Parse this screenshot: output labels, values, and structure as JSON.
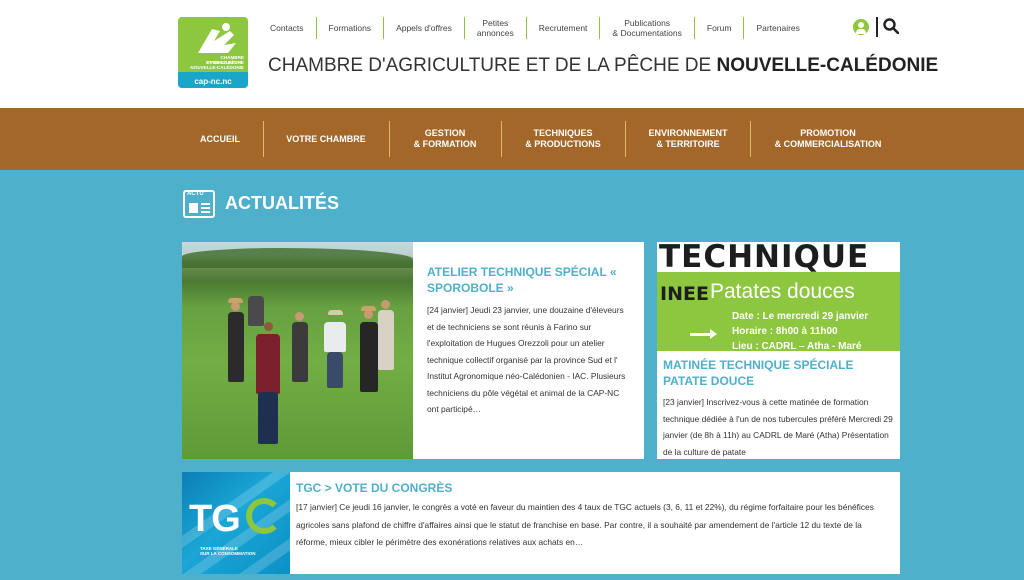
{
  "logo": {
    "lines": [
      "CHAMBRE D'AGRICULTURE",
      "ET DE LA PÊCHE",
      "NOUVELLE-CALÉDONIE"
    ],
    "url": "cap-nc.nc"
  },
  "topnav": [
    {
      "label": "Contacts"
    },
    {
      "label": "Formations"
    },
    {
      "label": "Appels d'offres"
    },
    {
      "label": "Petites\nannonces"
    },
    {
      "label": "Recrutement"
    },
    {
      "label": "Publications\n& Documentations"
    },
    {
      "label": "Forum"
    },
    {
      "label": "Partenaires"
    }
  ],
  "header": {
    "title_prefix": "CHAMBRE D'AGRICULTURE ET DE LA PÊCHE DE ",
    "title_bold": "NOUVELLE-CALÉDONIE"
  },
  "mainnav": [
    {
      "label": "ACCUEIL"
    },
    {
      "label": "VOTRE CHAMBRE"
    },
    {
      "label": "GESTION\n& FORMATION"
    },
    {
      "label": "TECHNIQUES\n& PRODUCTIONS"
    },
    {
      "label": "ENVIRONNEMENT\n& TERRITOIRE"
    },
    {
      "label": "PROMOTION\n& COMMERCIALISATION"
    }
  ],
  "section": {
    "icon_tag": "ACTU",
    "title": "ACTUALITÉS"
  },
  "articles": [
    {
      "title": "ATELIER TECHNIQUE SPÉCIAL « SPOROBOLE »",
      "text": "[24 janvier] Jeudi 23 janvier, une douzaine d'éleveurs et de techniciens se sont réunis à Farino sur l'exploitation de Hugues Orezzoli pour un atelier technique collectif organisé par la province Sud et l' Institut Agronomique néo-Calédonien - IAC. Plusieurs techniciens du pôle végétal et animal de la CAP-NC ont participé…"
    },
    {
      "title": "MATINÉE TECHNIQUE SPÉCIALE PATATE DOUCE",
      "text": "[23 janvier] Inscrivez-vous à cette matinée de formation technique dédiée à l'un de nos tubercules préféré  Mercredi 29 janvier (de 8h à 11h) au CADRL de Maré (Atha) Présentation de la culture de patate",
      "poster": {
        "heading": "TECHNIQUE",
        "vertical": "INEE",
        "subtitle": "Patates douces",
        "lines": [
          "Date : Le mercredi 29 janvier",
          "Horaire : 8h00 à 11h00",
          "Lieu : CADRL – Atha - Maré"
        ]
      }
    },
    {
      "title": "TGC > VOTE DU CONGRÈS",
      "text": "[17 janvier] Ce jeudi 16 janvier, le congrès a voté en faveur du maintien des 4 taux de TGC actuels (3, 6, 11 et 22%), du régime forfaitaire pour les bénéfices agricoles sans plafond de chiffre d'affaires ainsi que le statut de franchise en base. Par contre, il a souhaité par amendement de l'article 12 du texte de la réforme, mieux cibler le périmètre des exonérations relatives aux achats en…",
      "image": {
        "logo": "TG",
        "caption": "TAXE GÉNÉRALE\nSUR LA CONSOMMATION"
      }
    }
  ],
  "icons": [
    "user-icon",
    "search-icon",
    "news-icon"
  ],
  "colors": {
    "green": "#8dc63f",
    "brown": "#a4672a",
    "blue": "#4fb0cb"
  }
}
